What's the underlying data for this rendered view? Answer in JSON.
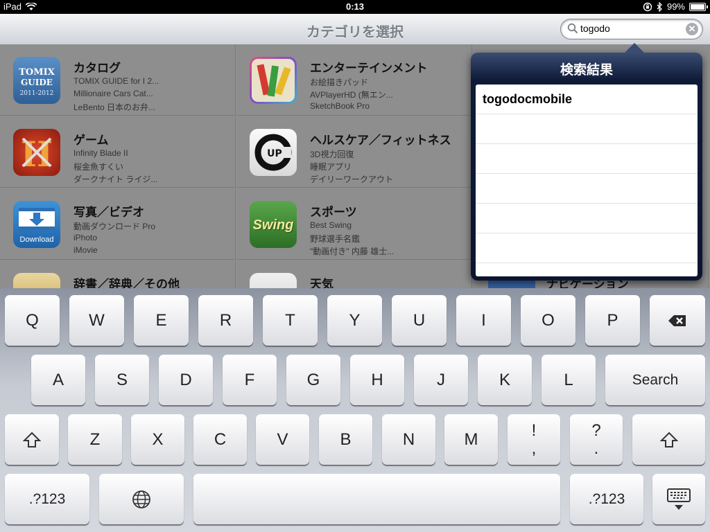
{
  "status_bar": {
    "device": "iPad",
    "time": "0:13",
    "battery": "99%",
    "battery_level": 0.99
  },
  "nav": {
    "title": "カテゴリを選択"
  },
  "search": {
    "value": "togodo",
    "placeholder": ""
  },
  "categories": [
    {
      "name": "カタログ",
      "apps": [
        "TOMIX GUIDE for I 2...",
        "Millionaire Cars Cat...",
        "LeBento 日本のお弁..."
      ],
      "icon": "tomix-guide-icon"
    },
    {
      "name": "エンターテインメント",
      "apps": [
        "お絵描きパッド",
        "AVPlayerHD (無エン...",
        "SketchBook Pro"
      ],
      "icon": "paint-icon"
    },
    {
      "name": "ゲーム",
      "apps": [
        "Infinity Blade II",
        "桜金魚すくい",
        "ダークナイト ライジ..."
      ],
      "icon": "infinity-blade-icon"
    },
    {
      "name": "ヘルスケア／フィットネス",
      "apps": [
        "3D視力回復",
        "睡眠アプリ",
        "デイリーワークアウト"
      ],
      "icon": "c-up-icon"
    },
    {
      "name": "写真／ビデオ",
      "apps": [
        "動画ダウンロード Pro",
        "iPhoto",
        "iMovie"
      ],
      "icon": "download-icon",
      "icon_label": "Download"
    },
    {
      "name": "スポーツ",
      "apps": [
        "Best Swing",
        "野球選手名鑑",
        "\"動画付き\" 内藤 雄士..."
      ],
      "icon": "swing-icon",
      "icon_label": "Swing"
    },
    {
      "name": "辞書／辞典／その他",
      "apps": [],
      "icon": "wisdom-icon"
    },
    {
      "name": "天気",
      "apps": [],
      "icon": "weather-icon"
    },
    {
      "name": "ナビゲーション",
      "apps": [],
      "icon": "navigation-icon"
    }
  ],
  "popover": {
    "title": "検索結果",
    "results": [
      "togodocmobile",
      "",
      "",
      "",
      "",
      ""
    ]
  },
  "keyboard": {
    "row1": [
      "Q",
      "W",
      "E",
      "R",
      "T",
      "Y",
      "U",
      "I",
      "O",
      "P"
    ],
    "row2": [
      "A",
      "S",
      "D",
      "F",
      "G",
      "H",
      "J",
      "K",
      "L"
    ],
    "search_label": "Search",
    "row3": [
      "Z",
      "X",
      "C",
      "V",
      "B",
      "N",
      "M"
    ],
    "exclaim_top": "!",
    "exclaim_bottom": ",",
    "question_top": "?",
    "question_bottom": ".",
    "numbers_label": ".?123"
  }
}
